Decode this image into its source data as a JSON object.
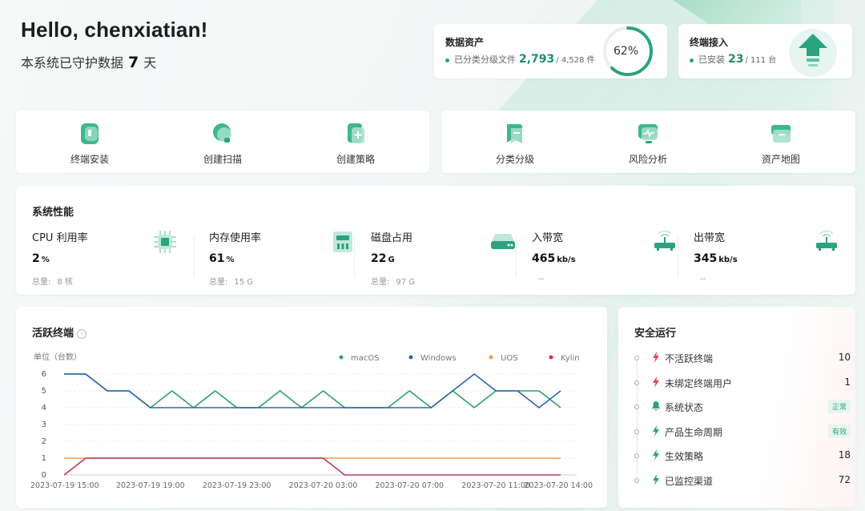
{
  "greeting": {
    "title": "Hello, chenxiatian!",
    "prefix": "本系统已守护数据",
    "days": "7",
    "suffix": "天"
  },
  "data_assets": {
    "title": "数据资产",
    "label": "已分类分级文件",
    "classified": "2,793",
    "total": "/ 4,528 件",
    "percent": 62,
    "percent_label": "62%"
  },
  "endpoint_access": {
    "title": "终端接入",
    "label": "已安装",
    "installed": "23",
    "total": "/ 111 台"
  },
  "quick_actions": [
    {
      "label": "终端安装",
      "icon": "shield-icon"
    },
    {
      "label": "创建扫描",
      "icon": "scan-icon"
    },
    {
      "label": "创建策略",
      "icon": "file-add-icon"
    },
    {
      "label": "分类分级",
      "icon": "bookmark-icon"
    },
    {
      "label": "风险分析",
      "icon": "monitor-icon"
    },
    {
      "label": "资产地图",
      "icon": "box-icon"
    }
  ],
  "performance": {
    "title": "系统性能",
    "metrics": [
      {
        "label": "CPU 利用率",
        "value": "2",
        "unit": "%",
        "total_label": "总量:",
        "total": "8 核",
        "icon": "cpu-icon"
      },
      {
        "label": "内存使用率",
        "value": "61",
        "unit": "%",
        "total_label": "总量:",
        "total": "15 G",
        "icon": "memory-icon"
      },
      {
        "label": "磁盘占用",
        "value": "22",
        "unit": "G",
        "total_label": "总量:",
        "total": "97 G",
        "icon": "disk-icon"
      },
      {
        "label": "入带宽",
        "value": "465",
        "unit": "kb/s",
        "total_label": "",
        "total": "--",
        "icon": "router-icon"
      },
      {
        "label": "出带宽",
        "value": "345",
        "unit": "kb/s",
        "total_label": "",
        "total": "--",
        "icon": "router-icon"
      }
    ]
  },
  "active_endpoints": {
    "title": "活跃终端",
    "info_icon": "i"
  },
  "security": {
    "title": "安全运行",
    "items": [
      {
        "label": "不活跃终端",
        "value": "10",
        "icon": "alert-bolt-icon",
        "color": "#e5484d"
      },
      {
        "label": "未绑定终端用户",
        "value": "1",
        "icon": "alert-bolt-icon",
        "color": "#e5484d"
      },
      {
        "label": "系统状态",
        "badge": "正常",
        "icon": "bell-icon",
        "color": "#2aa37e"
      },
      {
        "label": "产品生命周期",
        "badge": "有效",
        "icon": "bolt-icon",
        "color": "#2aa37e"
      },
      {
        "label": "生效策略",
        "value": "18",
        "icon": "bolt-icon",
        "color": "#2aa37e"
      },
      {
        "label": "已监控渠道",
        "value": "72",
        "icon": "bolt-icon",
        "color": "#2aa37e"
      }
    ]
  },
  "colors": {
    "accent": "#2aa37e",
    "danger": "#e5484d"
  },
  "chart_data": {
    "type": "line",
    "ylabel": "单位（台数）",
    "ylim": [
      0,
      6
    ],
    "yticks": [
      0,
      1,
      2,
      3,
      4,
      5,
      6
    ],
    "grid": true,
    "legend": "top-right",
    "x_tick_labels": [
      "2023-07-19 15:00",
      "2023-07-19 19:00",
      "2023-07-19 23:00",
      "2023-07-20 03:00",
      "2023-07-20 07:00",
      "2023-07-20 11:00",
      "2023-07-20 14:00"
    ],
    "x_tick_hours": [
      0,
      4,
      8,
      12,
      16,
      20,
      23
    ],
    "series": [
      {
        "name": "macOS",
        "color": "#2e9e76",
        "x": [
          0,
          1,
          2,
          3,
          4,
          5,
          6,
          7,
          8,
          9,
          10,
          11,
          12,
          13,
          14,
          15,
          16,
          17,
          18,
          19,
          20,
          21,
          22,
          23
        ],
        "values": [
          6,
          6,
          5,
          5,
          4,
          5,
          4,
          5,
          4,
          4,
          5,
          4,
          5,
          4,
          4,
          4,
          5,
          4,
          5,
          4,
          5,
          5,
          5,
          4
        ]
      },
      {
        "name": "Windows",
        "color": "#2f63b3",
        "x": [
          0,
          1,
          2,
          3,
          4,
          5,
          6,
          7,
          8,
          9,
          10,
          11,
          12,
          13,
          14,
          15,
          16,
          17,
          18,
          19,
          20,
          21,
          22,
          23
        ],
        "values": [
          6,
          6,
          5,
          5,
          4,
          4,
          4,
          4,
          4,
          4,
          4,
          4,
          4,
          4,
          4,
          4,
          4,
          4,
          5,
          6,
          5,
          5,
          4,
          5
        ]
      },
      {
        "name": "UOS",
        "color": "#f0a04b",
        "x": [
          0,
          23
        ],
        "values": [
          1,
          1
        ]
      },
      {
        "name": "Kylin",
        "color": "#c2336b",
        "x": [
          0,
          1,
          2,
          3,
          4,
          5,
          6,
          7,
          8,
          9,
          10,
          11,
          12,
          13,
          14,
          15,
          16,
          17,
          18,
          19,
          20,
          21,
          22,
          23
        ],
        "values": [
          0,
          1,
          1,
          1,
          1,
          1,
          1,
          1,
          1,
          1,
          1,
          1,
          1,
          0,
          0,
          0,
          0,
          0,
          0,
          0,
          0,
          0,
          0,
          0
        ]
      }
    ]
  }
}
